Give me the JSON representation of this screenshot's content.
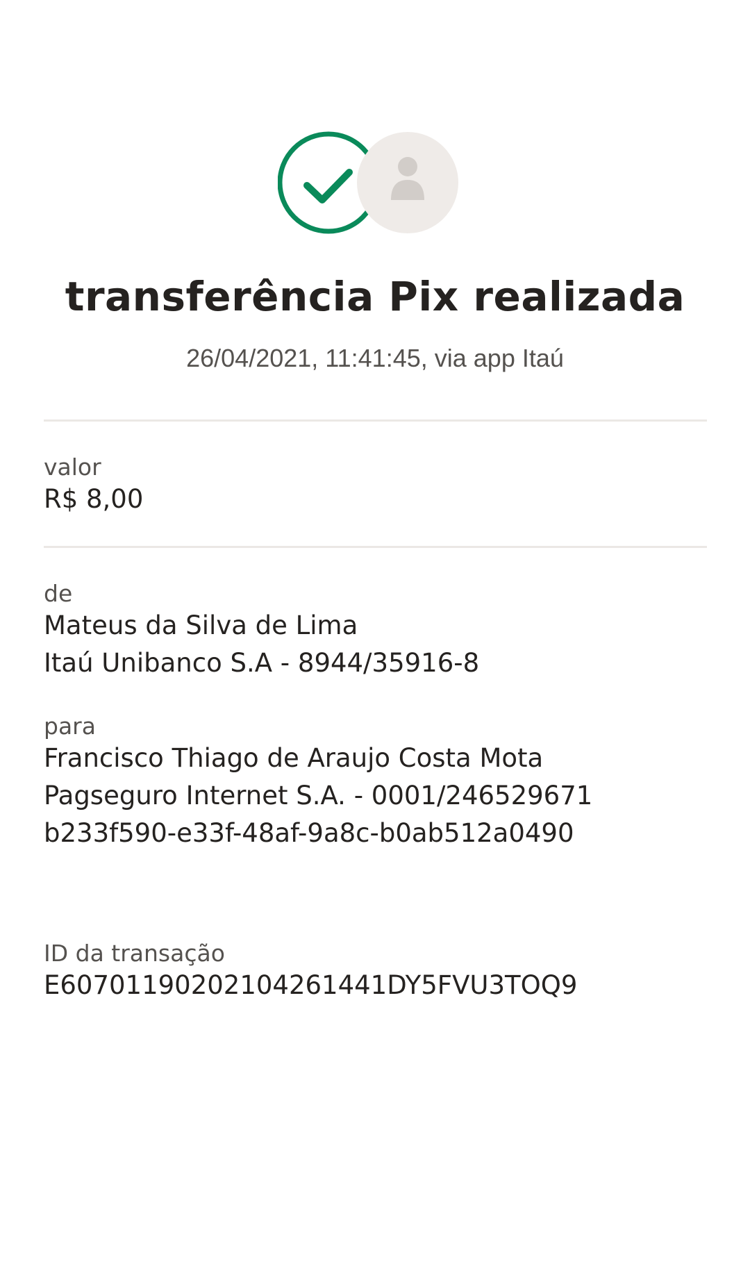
{
  "header": {
    "success_icon": "check-circle-icon",
    "avatar_icon": "person-avatar-icon",
    "colors": {
      "success": "#0a8a5a",
      "avatar_bg": "#efebe8",
      "avatar_fg": "#d2cdc9"
    },
    "title": "transferência Pix realizada",
    "subtitle": "26/04/2021,  11:41:45, via app Itaú"
  },
  "amount": {
    "label": "valor",
    "value": "R$ 8,00"
  },
  "sender": {
    "label": "de",
    "name": "Mateus da Silva de Lima",
    "account": "Itaú Unibanco S.A - 8944/35916-8"
  },
  "recipient": {
    "label": "para",
    "name": "Francisco Thiago de Araujo Costa Mota",
    "account": "Pagseguro Internet S.A. - 0001/246529671",
    "key": "b233f590-e33f-48af-9a8c-b0ab512a0490"
  },
  "transaction": {
    "label": "ID da transação",
    "id": "E60701190202104261441DY5FVU3TOQ9"
  }
}
